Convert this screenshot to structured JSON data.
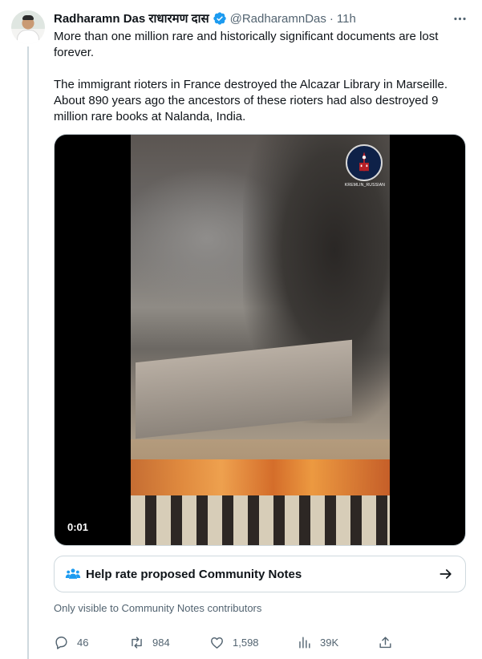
{
  "tweet": {
    "display_name": "Radharamn Das राधारमण दास",
    "handle": "@RadharamnDas",
    "separator": "·",
    "time": "11h",
    "paragraphs": [
      "More than one million rare and historically significant documents are lost forever.",
      "The immigrant rioters in France destroyed the Alcazar Library in Marseille. About 890 years ago the ancestors of these rioters had also destroyed 9 million rare books at Nalanda, India."
    ]
  },
  "media": {
    "timer": "0:01",
    "watermark": "KREMLIN_RUSSIAN"
  },
  "community_notes": {
    "prompt_label": "Help rate proposed Community Notes",
    "visibility_text": "Only visible to Community Notes contributors"
  },
  "actions": {
    "replies": "46",
    "reposts": "984",
    "likes": "1,598",
    "views": "39K"
  },
  "colors": {
    "accent": "#1d9bf0",
    "text_primary": "#0f1419",
    "text_secondary": "#536471",
    "border": "#cfd9de"
  },
  "icons": [
    "verified-badge-icon",
    "more-icon",
    "community-notes-icon",
    "arrow-right-icon",
    "reply-icon",
    "repost-icon",
    "like-icon",
    "views-icon",
    "share-icon"
  ]
}
